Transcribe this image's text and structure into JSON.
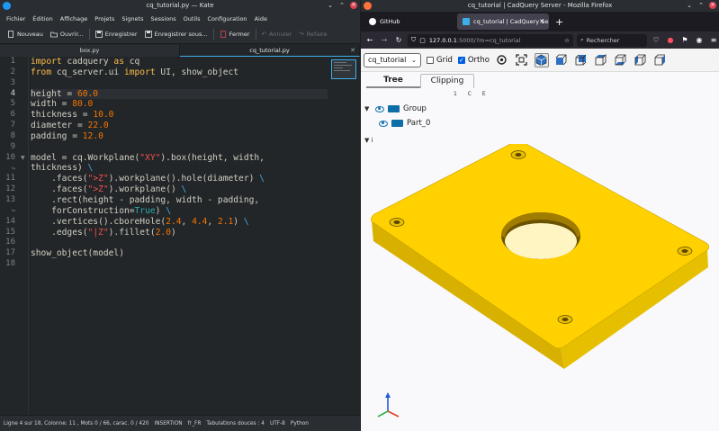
{
  "kate": {
    "title": "cq_tutorial.py — Kate",
    "menu": [
      "Fichier",
      "Édition",
      "Affichage",
      "Projets",
      "Signets",
      "Sessions",
      "Outils",
      "Configuration",
      "Aide"
    ],
    "toolbar": {
      "new": "Nouveau",
      "open": "Ouvrir...",
      "save": "Enregistrer",
      "save_as": "Enregistrer sous...",
      "close": "Fermer",
      "undo": "Annuler",
      "redo": "Refaire"
    },
    "tabs": [
      "box.py",
      "cq_tutorial.py"
    ],
    "line_numbers": [
      "1",
      "2",
      "3",
      "4",
      "5",
      "6",
      "7",
      "8",
      "9",
      "10",
      "",
      "11",
      "12",
      "13",
      "",
      "14",
      "15",
      "16",
      "17",
      "18"
    ],
    "status": {
      "position": "Ligne 4 sur 18, Colonne: 11 , Mots 0 / 66, carac. 0 / 420",
      "mode": "INSERTION",
      "lang": "fr_FR",
      "tabs": "Tabulations douces : 4",
      "encoding": "UTF-8",
      "syntax": "Python"
    }
  },
  "firefox": {
    "title": "cq_tutorial | CadQuery Server - Mozilla Firefox",
    "tabs": [
      "GitHub",
      "cq_tutorial | CadQuery Ser"
    ],
    "url_host": "127.0.0.1",
    "url_rest": ":5000/?m=cq_tutorial",
    "search_placeholder": "Rechercher",
    "cq": {
      "model_select": "cq_tutorial",
      "grid_label": "Grid",
      "ortho_label": "Ortho",
      "tree_tab": "Tree",
      "clipping_tab": "Clipping",
      "header_letters": "1 C E",
      "group_label": "Group",
      "part_label": "Part_0",
      "info_label": "i"
    }
  },
  "colors": {
    "model_yellow": "#ffd100",
    "accent": "#3daee9",
    "tree_blue": "#0d6ea8"
  }
}
